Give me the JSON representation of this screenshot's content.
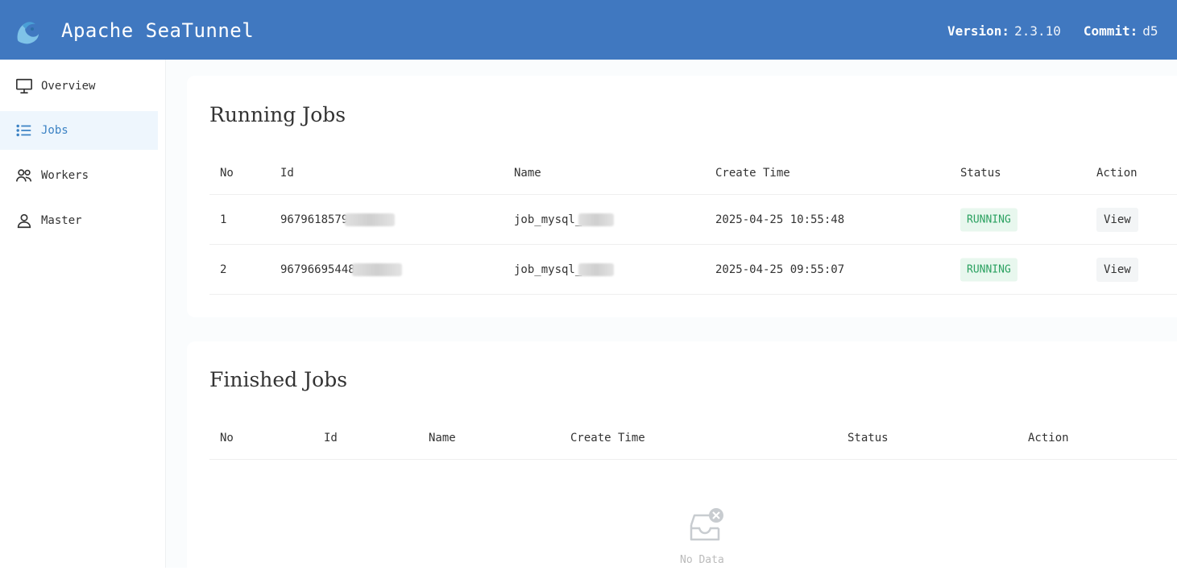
{
  "header": {
    "title": "Apache SeaTunnel",
    "version_label": "Version:",
    "version_value": "2.3.10",
    "commit_label": "Commit:",
    "commit_value": "d5"
  },
  "sidebar": {
    "items": [
      {
        "label": "Overview",
        "icon": "monitor-icon"
      },
      {
        "label": "Jobs",
        "icon": "list-icon",
        "active": true
      },
      {
        "label": "Workers",
        "icon": "users-icon"
      },
      {
        "label": "Master",
        "icon": "user-icon"
      }
    ]
  },
  "running": {
    "title": "Running Jobs",
    "columns": [
      "No",
      "Id",
      "Name",
      "Create Time",
      "Status",
      "Action"
    ],
    "rows": [
      {
        "no": "1",
        "id": "9679618579",
        "name": "job_mysql_",
        "create_time": "2025-04-25 10:55:48",
        "status": "RUNNING",
        "action": "View"
      },
      {
        "no": "2",
        "id": "96796695448",
        "name": "job_mysql_",
        "create_time": "2025-04-25 09:55:07",
        "status": "RUNNING",
        "action": "View"
      }
    ]
  },
  "finished": {
    "title": "Finished Jobs",
    "columns": [
      "No",
      "Id",
      "Name",
      "Create Time",
      "Status",
      "Action"
    ],
    "empty_text": "No Data"
  },
  "colors": {
    "header_bg": "#4078c0",
    "active_nav_bg": "#eef6fd",
    "running_badge": "#2aa160"
  }
}
